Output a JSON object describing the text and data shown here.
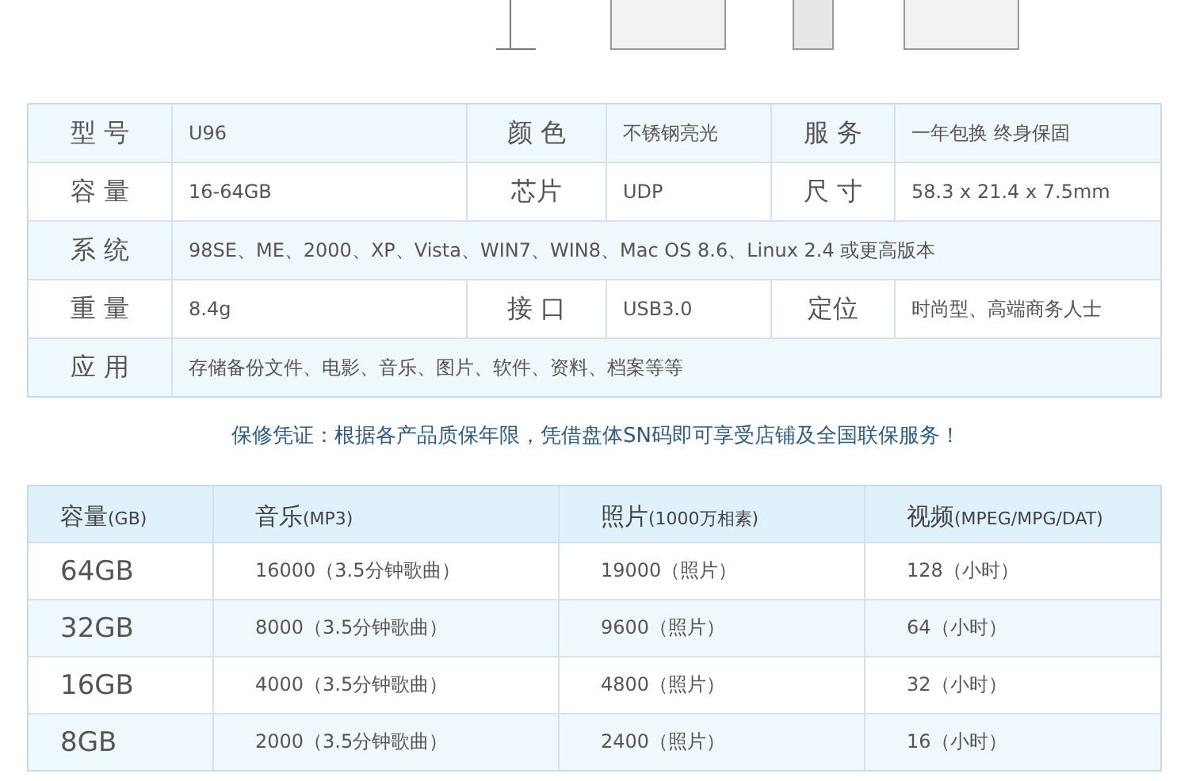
{
  "spec_table": {
    "rows": [
      [
        {
          "label": "型 号",
          "value": "U96"
        },
        {
          "label": "颜 色",
          "value": "不锈钢亮光"
        },
        {
          "label": "服 务",
          "value": "一年包换 终身保固"
        }
      ],
      [
        {
          "label": "容 量",
          "value": "16-64GB"
        },
        {
          "label": "芯片",
          "value": "UDP"
        },
        {
          "label": "尺 寸",
          "value": "58.3 x 21.4 x 7.5mm"
        }
      ],
      [
        {
          "label": "系 统",
          "value": "98SE、ME、2000、XP、Vista、WIN7、WIN8、Mac OS 8.6、Linux 2.4 或更高版本"
        }
      ],
      [
        {
          "label": "重 量",
          "value": "8.4g"
        },
        {
          "label": "接 口",
          "value": "USB3.0"
        },
        {
          "label": "定位",
          "value": "时尚型、高端商务人士"
        }
      ],
      [
        {
          "label": "应 用",
          "value": "存储备份文件、电影、音乐、图片、软件、资料、档案等等"
        }
      ]
    ]
  },
  "warranty_notice": "保修凭证：根据各产品质保年限，凭借盘体SN码即可享受店铺及全国联保服务！",
  "capacity_table": {
    "columns": [
      {
        "main": "容量",
        "unit": "(GB)"
      },
      {
        "main": "音乐",
        "unit": "(MP3)"
      },
      {
        "main": "照片",
        "unit": "(1000万相素)"
      },
      {
        "main": "视频",
        "unit": "(MPEG/MPG/DAT)"
      }
    ],
    "rows": [
      [
        "64GB",
        "16000（3.5分钟歌曲）",
        "19000（照片）",
        "128（小时）"
      ],
      [
        "32GB",
        "8000（3.5分钟歌曲）",
        "9600（照片）",
        "64（小时）"
      ],
      [
        "16GB",
        "4000（3.5分钟歌曲）",
        "4800（照片）",
        "32（小时）"
      ],
      [
        "8GB",
        "2000（3.5分钟歌曲）",
        "2400（照片）",
        "16（小时）"
      ]
    ]
  }
}
